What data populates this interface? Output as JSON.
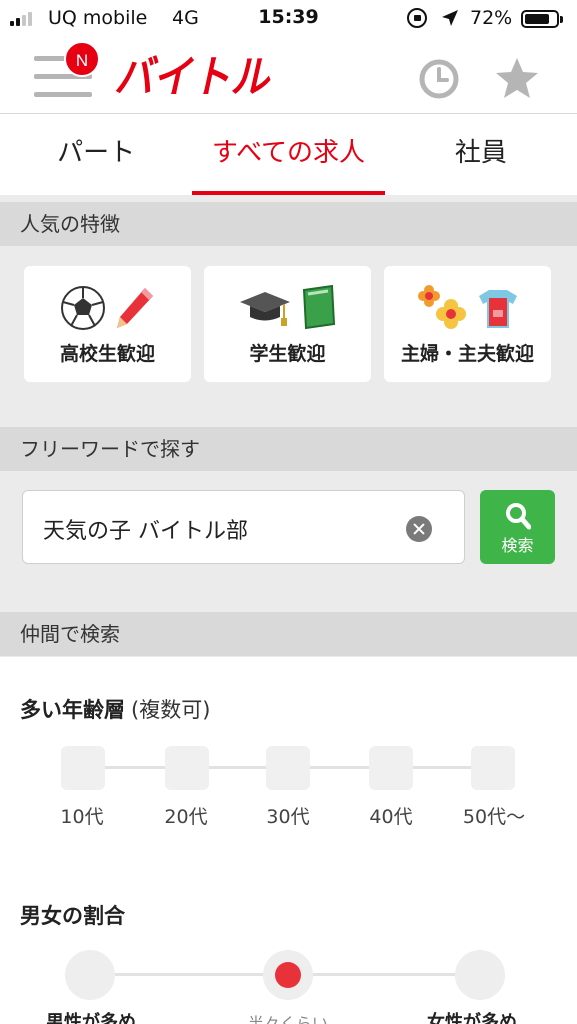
{
  "status_bar": {
    "carrier": "UQ mobile",
    "network": "4G",
    "time": "15:39",
    "battery_percent": "72%",
    "battery_level": 0.72
  },
  "header": {
    "notification_badge": "N",
    "logo_text": "バイトル",
    "brand_color": "#e60012"
  },
  "tabs": [
    {
      "label": "パート",
      "active": false
    },
    {
      "label": "すべての求人",
      "active": true
    },
    {
      "label": "社員",
      "active": false
    }
  ],
  "features": {
    "heading": "人気の特徴",
    "cards": [
      {
        "label": "高校生歓迎",
        "icons": [
          "soccer-ball-icon",
          "pencil-icon"
        ]
      },
      {
        "label": "学生歓迎",
        "icons": [
          "graduation-cap-icon",
          "book-icon"
        ]
      },
      {
        "label": "主婦・主夫歓迎",
        "icons": [
          "flowers-icon",
          "apron-icon"
        ]
      }
    ]
  },
  "freeword": {
    "heading": "フリーワードで探す",
    "value": "天気の子 バイトル部",
    "search_button": "検索",
    "button_color": "#3fb449"
  },
  "companions": {
    "heading": "仲間で検索",
    "age": {
      "title": "多い年齢層",
      "note": "(複数可)",
      "options": [
        "10代",
        "20代",
        "30代",
        "40代",
        "50代〜"
      ]
    },
    "gender": {
      "title": "男女の割合",
      "options": [
        "男性が多め",
        "半々くらい",
        "女性が多め"
      ],
      "selected_index": 1
    }
  }
}
